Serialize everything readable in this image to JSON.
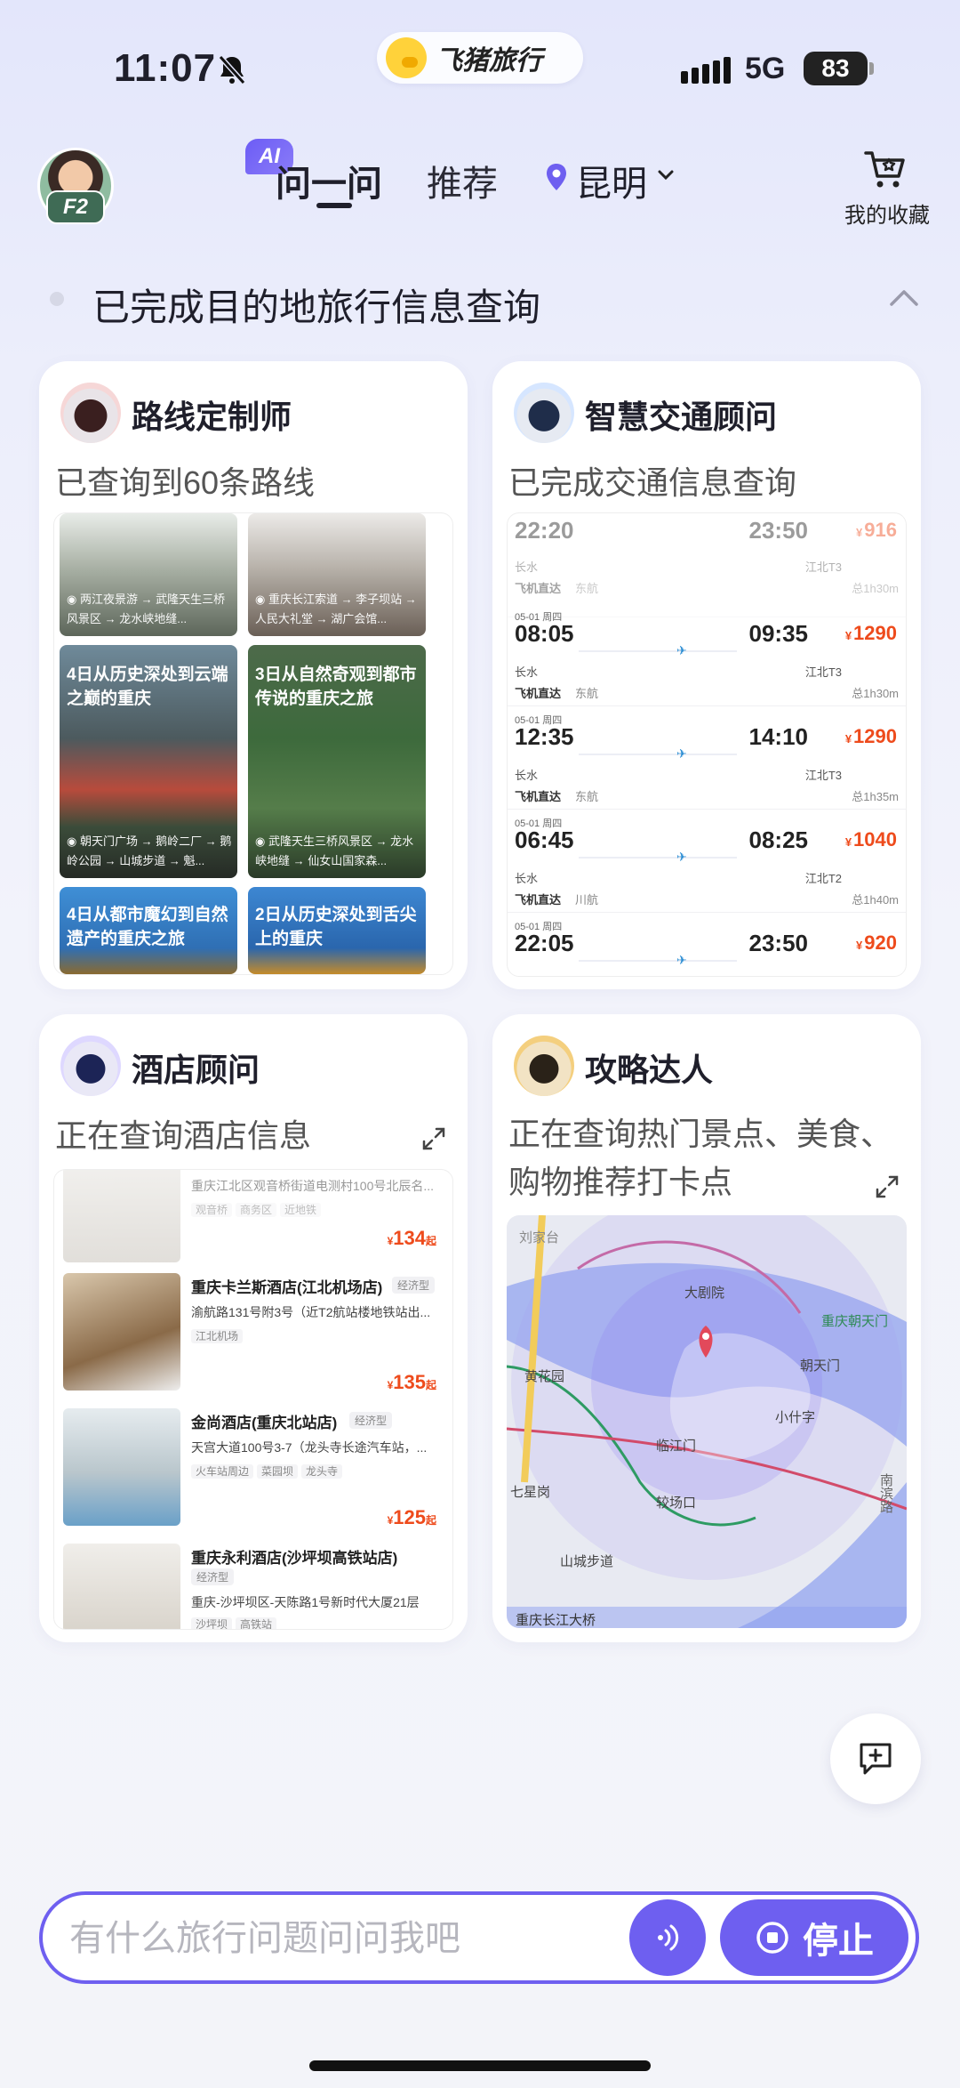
{
  "status_bar": {
    "time": "11:07",
    "network": "5G",
    "battery": "83"
  },
  "brand": {
    "name": "飞猪旅行"
  },
  "header": {
    "avatar_badge": "F2",
    "ai_badge": "AI",
    "tabs": [
      {
        "label": "问一问",
        "active": true
      },
      {
        "label": "推荐",
        "active": false
      }
    ],
    "city": "昆明",
    "favorites_label": "我的收藏"
  },
  "status_line": {
    "text": "已完成目的地旅行信息查询"
  },
  "cards": {
    "route": {
      "title": "路线定制师",
      "subtitle": "已查询到60条路线",
      "tiles": [
        {
          "title": "",
          "route": "◉ 两江夜景游 → 武隆天生三桥风景区 → 龙水峡地缝..."
        },
        {
          "title": "",
          "route": "◉ 重庆长江索道 → 李子坝站 → 人民大礼堂 → 湖广会馆..."
        },
        {
          "title": "4日从历史深处到云端之巅的重庆",
          "route": "◉ 朝天门广场 → 鹅岭二厂 → 鹅岭公园 → 山城步道 → 魁..."
        },
        {
          "title": "3日从自然奇观到都市传说的重庆之旅",
          "route": "◉ 武隆天生三桥风景区 → 龙水峡地缝 → 仙女山国家森..."
        },
        {
          "title": "4日从都市魔幻到自然遗产的重庆之旅",
          "route": ""
        },
        {
          "title": "2日从历史深处到舌尖上的重庆",
          "route": ""
        }
      ]
    },
    "transport": {
      "title": "智慧交通顾问",
      "subtitle": "已完成交通信息查询",
      "flights": [
        {
          "date": "",
          "dep": "22:20",
          "arr": "23:50",
          "price": "916",
          "from": "长水",
          "to": "江北T3",
          "type": "飞机直达",
          "airline": "东航",
          "duration": "总1h30m"
        },
        {
          "date": "05-01 周四",
          "dep": "08:05",
          "arr": "09:35",
          "price": "1290",
          "from": "长水",
          "to": "江北T3",
          "type": "飞机直达",
          "airline": "东航",
          "duration": "总1h30m"
        },
        {
          "date": "05-01 周四",
          "dep": "12:35",
          "arr": "14:10",
          "price": "1290",
          "from": "长水",
          "to": "江北T3",
          "type": "飞机直达",
          "airline": "东航",
          "duration": "总1h35m"
        },
        {
          "date": "05-01 周四",
          "dep": "06:45",
          "arr": "08:25",
          "price": "1040",
          "from": "长水",
          "to": "江北T2",
          "type": "飞机直达",
          "airline": "川航",
          "duration": "总1h40m"
        },
        {
          "date": "05-01 周四",
          "dep": "22:05",
          "arr": "23:50",
          "price": "920",
          "from": "",
          "to": "",
          "type": "",
          "airline": "",
          "duration": ""
        }
      ]
    },
    "hotel": {
      "title": "酒店顾问",
      "subtitle": "正在查询酒店信息",
      "hotels": [
        {
          "name": "",
          "type": "",
          "addr": "重庆江北区观音桥街道电测村100号北辰名...",
          "tags": [
            "观音桥",
            "商务区",
            "近地铁"
          ],
          "price": "134"
        },
        {
          "name": "重庆卡兰斯酒店(江北机场店)",
          "type": "经济型",
          "addr": "渝航路131号附3号（近T2航站楼地铁站出...",
          "tags": [
            "江北机场"
          ],
          "price": "135"
        },
        {
          "name": "金尚酒店(重庆北站店)",
          "type": "经济型",
          "addr": "天宫大道100号3-7（龙头寺长途汽车站，...",
          "tags": [
            "火车站周边",
            "菜园坝",
            "龙头寺"
          ],
          "price": "125"
        },
        {
          "name": "重庆永利酒店(沙坪坝高铁站店)",
          "type": "经济型",
          "addr": "重庆-沙坪坝区-天陈路1号新时代大厦21层",
          "tags": [
            "沙坪坝",
            "高铁站"
          ],
          "price": ""
        }
      ],
      "price_prefix": "¥",
      "price_suffix": "起"
    },
    "guide": {
      "title": "攻略达人",
      "subtitle": "正在查询热门景点、美食、购物推荐打卡点",
      "map_labels": [
        "刘家台",
        "大剧院",
        "重庆朝天门",
        "黄花园",
        "朝天门",
        "小什字",
        "临江门",
        "七星岗",
        "较场口",
        "山城步道",
        "南滨路",
        "重庆长江大桥"
      ]
    }
  },
  "input": {
    "placeholder": "有什么旅行问题问问我吧",
    "stop_label": "停止"
  },
  "colors": {
    "accent": "#6e5ff0",
    "price": "#ee4b1c"
  }
}
